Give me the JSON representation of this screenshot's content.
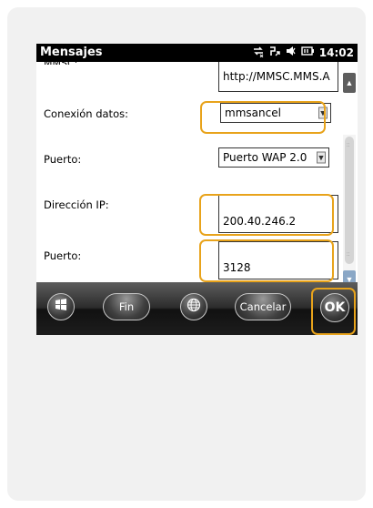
{
  "statusbar": {
    "title": "Mensajes",
    "time": "14:02",
    "icons": [
      "signal-arrows-icon",
      "data-connection-icon",
      "speaker-icon",
      "battery-icon"
    ]
  },
  "form": {
    "mmsc_value": "http://MMSC.MMS.A",
    "conexion_label": "Conexión datos:",
    "conexion_value": "mmsancel",
    "puerto_wap_label": "Puerto:",
    "puerto_wap_value": "Puerto WAP 2.0",
    "ip_label": "Dirección IP:",
    "ip_value": "200.40.246.2",
    "port_label": "Puerto:",
    "port_value": "3128"
  },
  "softkeys": {
    "start_icon": "windows-logo-icon",
    "fin_label": "Fin",
    "globe_icon": "globe-icon",
    "cancel_label": "Cancelar",
    "ok_label": "OK"
  },
  "colors": {
    "highlight": "#e8a31b",
    "statusbar_bg": "#000000",
    "softbar_bg": "#2c2c2c"
  }
}
